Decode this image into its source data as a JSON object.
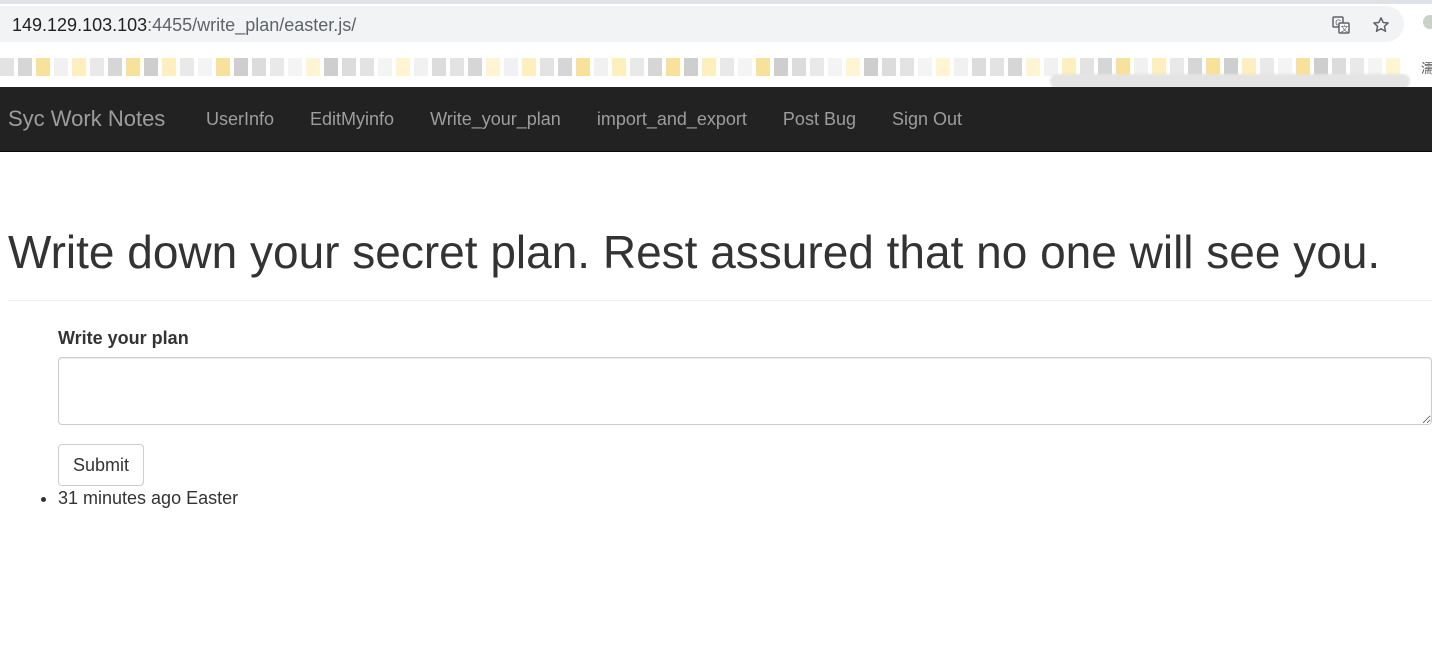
{
  "browser": {
    "url_host": "149.129.103.103",
    "url_rest": ":4455/write_plan/easter.js/",
    "bookmark_char": "濡",
    "translate_icon": "translate-icon",
    "star_icon": "star-icon"
  },
  "navbar": {
    "brand": "Syc Work Notes",
    "links": [
      {
        "label": "UserInfo"
      },
      {
        "label": "EditMyinfo"
      },
      {
        "label": "Write_your_plan"
      },
      {
        "label": "import_and_export"
      },
      {
        "label": "Post Bug"
      },
      {
        "label": "Sign Out"
      }
    ]
  },
  "main": {
    "title": "Write down your secret plan. Rest assured that no one will see you.",
    "form": {
      "label": "Write your plan",
      "textarea_value": "",
      "submit_label": "Submit"
    },
    "plans": [
      {
        "text": "31 minutes ago Easter"
      }
    ]
  },
  "colors": {
    "navbar_bg": "#222222",
    "nav_text": "#9d9d9d",
    "body_text": "#333333"
  }
}
